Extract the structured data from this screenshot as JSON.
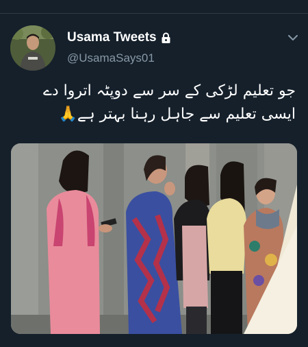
{
  "tweet": {
    "display_name": "Usama Tweets",
    "handle": "@UsamaSays01",
    "text_line_1": "جو تعلیم لڑکی کے سر سے دوپٹہ اتروا دے",
    "text_line_2": "ایسی تعلیم سے جاہل رہنا بہتر ہے🙏",
    "protected": true
  },
  "icons": {
    "lock": "lock-icon",
    "more": "chevron-down-icon",
    "prayer_emoji": "folded-hands-emoji"
  },
  "colors": {
    "background": "#15202b",
    "secondary_text": "#8899a6",
    "divider": "#2f3d4a"
  }
}
